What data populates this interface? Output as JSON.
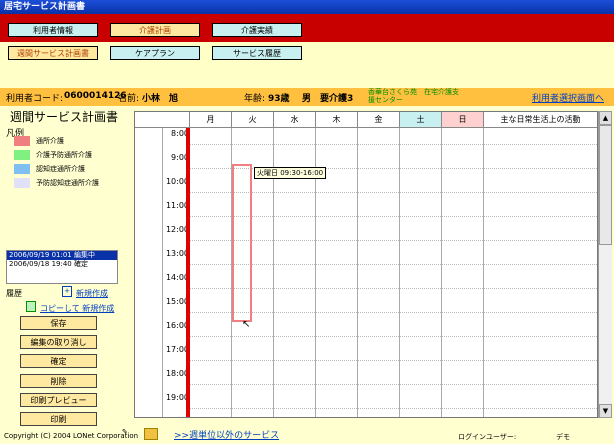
{
  "window_title": "居宅サービス計画書",
  "top_nav": [
    "利用者情報",
    "介護計画",
    "介護実績"
  ],
  "sub_nav": [
    "週間サービス計画書",
    "ケアプラン",
    "サービス履歴"
  ],
  "info": {
    "code_label": "利用者コード:",
    "code": "0600014126",
    "name_label": "名前:",
    "name": "小林　旭",
    "age_label": "年齢:",
    "age": "93歳",
    "gender": "男",
    "care_level": "要介護3",
    "facility": "香華台さくら苑　在宅介護支援センター",
    "select_link": "利用者選択画面へ"
  },
  "page_heading": "週間サービス計画書",
  "legend": {
    "title": "凡例",
    "items": [
      {
        "label": "通所介護",
        "color": "#f08080"
      },
      {
        "label": "介護予防通所介護",
        "color": "#80f080"
      },
      {
        "label": "認知症通所介護",
        "color": "#80c0f0"
      },
      {
        "label": "予防認知症通所介護",
        "color": "#e0e0f8"
      }
    ]
  },
  "history": [
    "2006/09/19 01:01 編集中",
    "2006/09/18 19:40 確定"
  ],
  "history_label": "履歴",
  "new_create": "新規作成",
  "copy_create": "コピーして 新規作成",
  "actions": [
    "保存",
    "編集の取り消し",
    "確定",
    "削除",
    "印刷プレビュー",
    "印刷"
  ],
  "days": [
    "月",
    "火",
    "水",
    "木",
    "金",
    "土",
    "日"
  ],
  "activities_header": "主な日常生活上の活動",
  "times": [
    "8:00",
    "9:00",
    "10:00",
    "11:00",
    "12:00",
    "13:00",
    "14:00",
    "15:00",
    "16:00",
    "17:00",
    "18:00",
    "19:00"
  ],
  "tooltip": "火曜日 09:30-16:00",
  "footer": {
    "copyright": "Copyright (C) 2004 LONet Corporation",
    "other_services": ">>週単位以外のサービス",
    "login_label": "ログインユーザー:",
    "login_user": "デモ"
  }
}
